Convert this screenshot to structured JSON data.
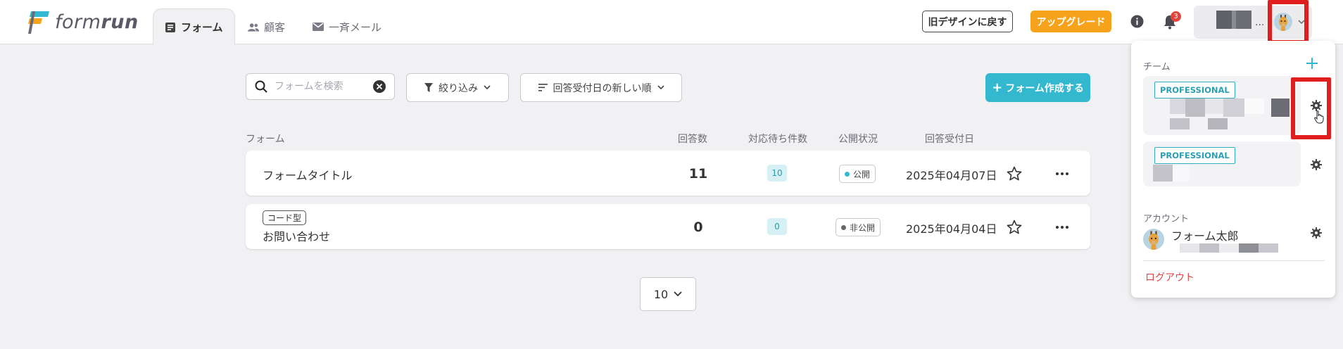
{
  "brand": {
    "name_light": "form",
    "name_bold": "run"
  },
  "nav": {
    "tabs": [
      {
        "label": "フォーム",
        "active": true
      },
      {
        "label": "顧客",
        "active": false
      },
      {
        "label": "一斉メール",
        "active": false
      }
    ]
  },
  "header": {
    "old_design_label": "旧デザインに戻す",
    "upgrade_label": "アップグレード",
    "notification_count": "3",
    "account_dots": "..."
  },
  "toolbar": {
    "search_placeholder": "フォームを検索",
    "filter_label": "絞り込み",
    "sort_label": "回答受付日の新しい順",
    "create_label": "フォーム作成する",
    "create_prefix": "+"
  },
  "table": {
    "columns": [
      "フォーム",
      "回答数",
      "対応待ち件数",
      "公開状況",
      "回答受付日"
    ],
    "rows": [
      {
        "tag": "",
        "title": "フォームタイトル",
        "responses": "11",
        "pending": "10",
        "status": "公開",
        "status_color": "#34b8d0",
        "date": "2025年04月07日"
      },
      {
        "tag": "コード型",
        "title": "お問い合わせ",
        "responses": "0",
        "pending": "0",
        "status": "非公開",
        "status_color": "#666666",
        "date": "2025年04月04日"
      }
    ]
  },
  "pager": {
    "page_size": "10"
  },
  "dropdown": {
    "team_label": "チーム",
    "teams": [
      {
        "plan": "PROFESSIONAL"
      },
      {
        "plan": "PROFESSIONAL"
      }
    ],
    "account_label": "アカウント",
    "account_name": "フォーム太郎",
    "logout_label": "ログアウト"
  },
  "colors": {
    "accent": "#34b8d0",
    "upgrade": "#f7a21b",
    "highlight": "#e01e1e",
    "logout": "#e04545"
  }
}
